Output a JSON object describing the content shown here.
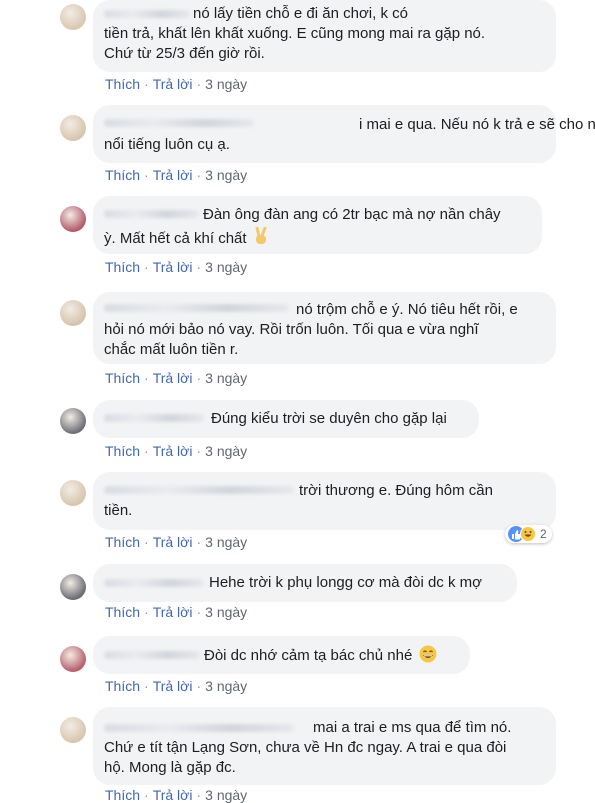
{
  "comments": [
    {
      "avatar_color": "#d9c7b0",
      "text_lines": [
        "nó lấy tiền chỗ e đi ăn chơi, k có",
        "tiền trả, khất lên khất xuống. E cũng mong mai ra gặp nó.",
        "Chứ từ 25/3 đến giờ rồi."
      ],
      "like": "Thích",
      "reply": "Trả lời",
      "time": "3 ngày"
    },
    {
      "avatar_color": "#d8c4ad",
      "text_lines": [
        "i mai e qua. Nếu nó k trả e sẽ cho nó",
        "nổi tiếng luôn cụ ạ."
      ],
      "like": "Thích",
      "reply": "Trả lời",
      "time": "3 ngày"
    },
    {
      "avatar_color": "#b35a6a",
      "text_lines": [
        "Đàn ông đàn ang có 2tr bạc mà nợ nần chây",
        "ỳ. Mất hết cả khí chất"
      ],
      "emoji_name": "victory-hand-icon",
      "like": "Thích",
      "reply": "Trả lời",
      "time": "3 ngày"
    },
    {
      "avatar_color": "#d6c3ab",
      "text_lines": [
        "nó trộm chỗ e ý. Nó tiêu hết rồi, e",
        "hỏi nó mới bảo nó vay. Rồi trốn luôn. Tối qua e vừa nghĩ",
        "chắc mất luôn tiền r."
      ],
      "like": "Thích",
      "reply": "Trả lời",
      "time": "3 ngày"
    },
    {
      "avatar_color": "#6e6f78",
      "text_lines": [
        "Đúng kiểu trời se duyên cho gặp lại"
      ],
      "like": "Thích",
      "reply": "Trả lời",
      "time": "3 ngày"
    },
    {
      "avatar_color": "#d7c5ae",
      "text_lines": [
        "trời thương e. Đúng hôm cần",
        "tiền."
      ],
      "reaction_count": "2",
      "like": "Thích",
      "reply": "Trả lời",
      "time": "3 ngày"
    },
    {
      "avatar_color": "#6b6c75",
      "text_lines": [
        "Hehe trời k phụ longg cơ mà đòi dc k mợ"
      ],
      "like": "Thích",
      "reply": "Trả lời",
      "time": "3 ngày"
    },
    {
      "avatar_color": "#b8606c",
      "text_lines": [
        "Đòi dc nhớ cảm tạ bác chủ nhé"
      ],
      "emoji_name": "grinning-face-icon",
      "like": "Thích",
      "reply": "Trả lời",
      "time": "3 ngày"
    },
    {
      "avatar_color": "#d8c6af",
      "text_lines": [
        "mai a trai e ms qua để tìm nó.",
        "Chứ e tít tận Lạng Sơn, chưa về Hn đc ngay. A trai e qua đòi",
        "hộ. Mong là gặp đc."
      ],
      "like": "Thích",
      "reply": "Trả lời",
      "time": "3 ngày"
    }
  ]
}
